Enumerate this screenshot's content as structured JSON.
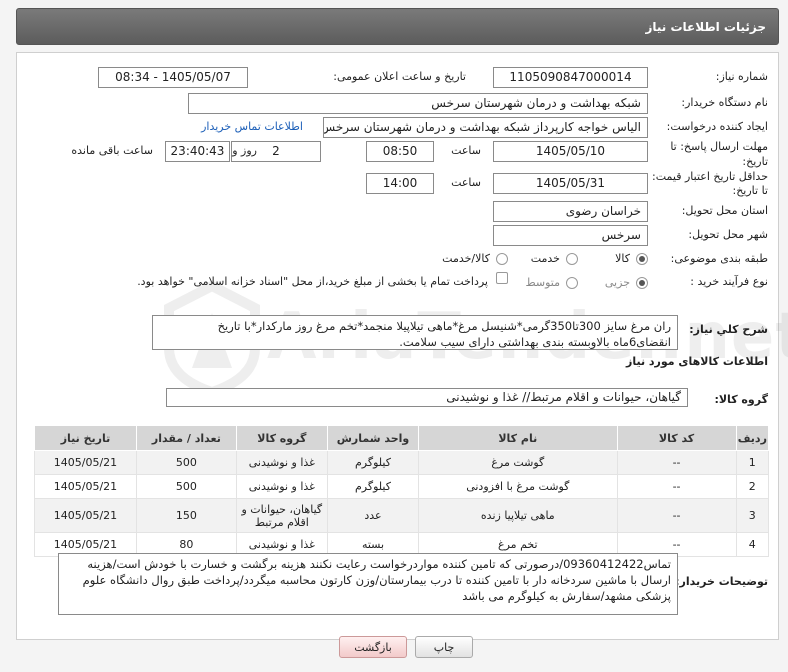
{
  "header": {
    "title": "جزئیات اطلاعات نیاز"
  },
  "fields": {
    "need_number_label": "شماره نیاز:",
    "need_number": "1105090847000014",
    "announce_label": "تاریخ و ساعت اعلان عمومی:",
    "announce_value": "1405/05/07 - 08:34",
    "buyer_org_label": "نام دستگاه خریدار:",
    "buyer_org": "شبکه بهداشت و درمان شهرستان سرخس",
    "creator_label": "ایجاد کننده درخواست:",
    "creator": "الیاس خواجه کارپرداز شبکه بهداشت و درمان شهرستان سرخس",
    "contact_link": "اطلاعات تماس خریدار",
    "reply_deadline_label": "مهلت ارسال پاسخ: تا تاریخ:",
    "reply_date": "1405/05/10",
    "time_label": "ساعت",
    "reply_time": "08:50",
    "days_value": "2",
    "days_label": "روز و",
    "remaining_time": "23:40:43",
    "remaining_label": "ساعت باقی مانده",
    "validity_label": "حداقل تاریخ اعتبار قیمت: تا تاریخ:",
    "validity_date": "1405/05/31",
    "validity_time_label": "ساعت",
    "validity_time": "14:00",
    "province_label": "استان محل تحویل:",
    "province": "خراسان رضوی",
    "city_label": "شهر محل تحویل:",
    "city": "سرخس",
    "category_label": "طبقه بندی موضوعی:",
    "category_options": [
      "کالا",
      "خدمت",
      "کالا/خدمت"
    ],
    "purchase_type_label": "نوع فرآیند خرید :",
    "purchase_options": [
      "جزیی",
      "متوسط"
    ],
    "payment_note": "پرداخت تمام یا بخشی از مبلغ خرید،از محل \"اسناد خزانه اسلامی\" خواهد بود."
  },
  "description": {
    "label": "شرح کلي نياز:",
    "text": "ران مرغ سایز 300تا350گرمی*شنیسل مرغ*ماهی تیلاپیلا منجمد*تخم مرغ روز مارکدار*با تاریخ انقضای6ماه بالاوبسته بندی بهداشتی دارای سیب سلامت."
  },
  "goods_section": {
    "title": "اطلاعات کالاهای مورد نیاز",
    "group_label": "گروه کالا:",
    "group_value": "گیاهان، حیوانات و اقلام مرتبط// غذا و نوشیدنی"
  },
  "table": {
    "headers": [
      "ردیف",
      "کد کالا",
      "نام کالا",
      "واحد شمارش",
      "گروه کالا",
      "تعداد / مقدار",
      "تاریخ نیاز"
    ],
    "rows": [
      [
        "1",
        "--",
        "گوشت مرغ",
        "کیلوگرم",
        "غذا و نوشیدنی",
        "500",
        "1405/05/21"
      ],
      [
        "2",
        "--",
        "گوشت مرغ با افزودنی",
        "کیلوگرم",
        "غذا و نوشیدنی",
        "500",
        "1405/05/21"
      ],
      [
        "3",
        "--",
        "ماهی تیلاپیا زنده",
        "عدد",
        "گیاهان، حیوانات و اقلام مرتبط",
        "150",
        "1405/05/21"
      ],
      [
        "4",
        "--",
        "تخم مرغ",
        "بسته",
        "غذا و نوشیدنی",
        "80",
        "1405/05/21"
      ]
    ]
  },
  "buyer_notes": {
    "label": "توضیحات خریدار:",
    "text": "تماس09360412422/درصورتی که تامین کننده مواردرخواست رعایت نکنند هزینه برگشت و خسارت با خودش است/هزینه ارسال با ماشین سردخانه دار با تامین کننده تا درب بیمارستان/وزن کارتون محاسبه میگردد/پرداخت طبق روال دانشگاه علوم پزشکی مشهد/سفارش به کیلوگرم می باشد"
  },
  "buttons": {
    "print": "چاپ",
    "back": "بازگشت"
  },
  "watermark": {
    "text": "AriaTender.net"
  }
}
